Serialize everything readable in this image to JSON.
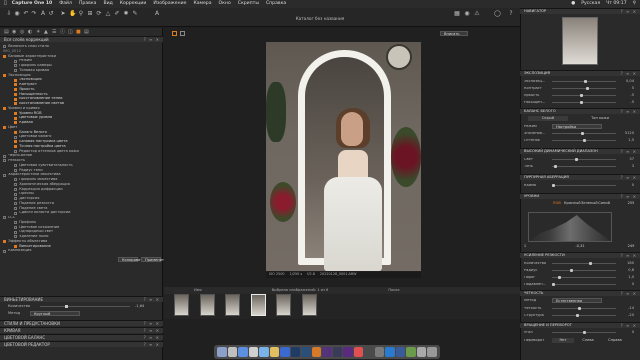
{
  "menubar": {
    "app_name": "Capture One 10",
    "items": [
      "Файл",
      "Правка",
      "Вид",
      "Коррекции",
      "Изображение",
      "Камера",
      "Окно",
      "Скрипты",
      "Справка"
    ],
    "status": {
      "language": "Русская",
      "clock": "Чт 09:17"
    }
  },
  "window": {
    "title": "Каталог без названия"
  },
  "viewer_toolbar": {
    "zoom_label": "Вписать"
  },
  "left_panel": {
    "layers_header": "Фоновый слой",
    "layers_header_sub": "Вся слоёв коррекций",
    "enable_layers": "Включить слои стиля",
    "tree_root": "IMG_0012",
    "items": [
      {
        "label": "Базовые характеристики",
        "level": 0,
        "on": true
      },
      {
        "label": "Режим",
        "level": 1,
        "on": false
      },
      {
        "label": "Профиль камеры",
        "level": 1,
        "on": false
      },
      {
        "label": "Тоновая кривая",
        "level": 1,
        "on": false
      },
      {
        "label": "Экспозиция",
        "level": 0,
        "on": true
      },
      {
        "label": "Экспозиция",
        "level": 1,
        "on": true
      },
      {
        "label": "Контраст",
        "level": 1,
        "on": true
      },
      {
        "label": "Яркость",
        "level": 1,
        "on": true
      },
      {
        "label": "Насыщенность",
        "level": 1,
        "on": true
      },
      {
        "label": "Восстановление теней",
        "level": 1,
        "on": true
      },
      {
        "label": "Восстановление светов",
        "level": 1,
        "on": true
      },
      {
        "label": "Уровни и кривая",
        "level": 0,
        "on": true
      },
      {
        "label": "Уровни RGB",
        "level": 1,
        "on": true
      },
      {
        "label": "Цветовые уровни",
        "level": 1,
        "on": true
      },
      {
        "label": "Кривая",
        "level": 1,
        "on": true
      },
      {
        "label": "Цвет",
        "level": 0,
        "on": true
      },
      {
        "label": "Баланс белого",
        "level": 1,
        "on": true
      },
      {
        "label": "Цветовой баланс",
        "level": 1,
        "on": false
      },
      {
        "label": "Базовая настройка цвета",
        "level": 1,
        "on": true
      },
      {
        "label": "Точная настройка цвета",
        "level": 1,
        "on": true
      },
      {
        "label": "Редактор оттенков цвета кожи",
        "level": 1,
        "on": false
      },
      {
        "label": "Черно-белое",
        "level": 0,
        "on": false
      },
      {
        "label": "Резкость",
        "level": 0,
        "on": false
      },
      {
        "label": "Цветовая чувствительность",
        "level": 1,
        "on": false
      },
      {
        "label": "Радиус тени",
        "level": 1,
        "on": false
      },
      {
        "label": "Характеристики объектива",
        "level": 0,
        "on": false
      },
      {
        "label": "Профиль объектива",
        "level": 1,
        "on": false
      },
      {
        "label": "Хроматическая аберрация",
        "level": 1,
        "on": false
      },
      {
        "label": "Коррекция дифракции",
        "level": 1,
        "on": false
      },
      {
        "label": "Ореолы",
        "level": 1,
        "on": false
      },
      {
        "label": "Дисторсия",
        "level": 1,
        "on": false
      },
      {
        "label": "Падение резкости",
        "level": 1,
        "on": false
      },
      {
        "label": "Падение света",
        "level": 1,
        "on": false
      },
      {
        "label": "Сдвиги области дисторсии",
        "level": 1,
        "on": false
      },
      {
        "label": "LCC",
        "level": 0,
        "on": false
      },
      {
        "label": "Профиль",
        "level": 1,
        "on": false
      },
      {
        "label": "Цветовое искажение",
        "level": 1,
        "on": false
      },
      {
        "label": "Однородный свет",
        "level": 1,
        "on": false
      },
      {
        "label": "Удаление пыли",
        "level": 1,
        "on": false
      },
      {
        "label": "Эффекты объектива",
        "level": 0,
        "on": true
      },
      {
        "label": "Виньетирование",
        "level": 1,
        "on": true
      },
      {
        "label": "Композиция",
        "level": 0,
        "on": false
      }
    ],
    "buttons": {
      "copy": "Копировать",
      "apply": "Применить"
    },
    "vignette": {
      "header": "ВИНЬЕТИРОВАНИЕ",
      "amount_label": "Количество",
      "amount_value": "-1,64",
      "method_label": "Метод",
      "method_value": "Круглый"
    },
    "bottom_sections": [
      "СТИЛИ И ПРЕДУСТАНОВКИ",
      "КРИВАЯ",
      "ЦВЕТОВОЙ БАЛАНС",
      "ЦВЕТОВОЙ РЕДАКТОР"
    ]
  },
  "photo_info": {
    "iso": "ISO 2500",
    "shutter": "1/250 s",
    "aperture": "f/2.8",
    "filename": "20220128_0001.ARW"
  },
  "filmstrip": {
    "sort_label": "Имя",
    "count_label": "Выбрано изображений: 1 из 6",
    "search_placeholder": "Поиск",
    "thumb_count": 6,
    "selected_index": 3
  },
  "right_panel": {
    "navigator": "НАВИГАТОР",
    "exposure": {
      "header": "ЭКСПОЗИЦИЯ",
      "rows": [
        {
          "label": "Экспозиц...",
          "value": "0,04",
          "pos": 0.52
        },
        {
          "label": "Контраст",
          "value": "5",
          "pos": 0.55
        },
        {
          "label": "Яркость",
          "value": "-5",
          "pos": 0.46
        },
        {
          "label": "Насыщен...",
          "value": "-5",
          "pos": 0.46
        }
      ]
    },
    "white_balance": {
      "header": "БАЛАНС БЕЛОГО",
      "tab_gray": "Серый",
      "tab_skin": "Тон кожи",
      "mode_label": "Режим",
      "mode_value": "Настройка",
      "rows": [
        {
          "label": "Значение...",
          "value": "5120",
          "pos": 0.48
        },
        {
          "label": "Оттенок",
          "value": "1,5",
          "pos": 0.51
        }
      ]
    },
    "hdr": {
      "header": "ВЫСОКИЙ ДИНАМИЧЕСКИЙ ДИАПАЗОН",
      "rows": [
        {
          "label": "Свет",
          "value": "37",
          "pos": 0.37
        },
        {
          "label": "Тень",
          "value": "3",
          "pos": 0.03
        }
      ]
    },
    "purple": {
      "header": "ПУРПУРНАЯ АБЕРРАЦИЯ",
      "rows": [
        {
          "label": "Кайма",
          "value": "0",
          "pos": 0.0
        }
      ]
    },
    "levels": {
      "header": "УРОВНИ",
      "channel_buttons": [
        "RGB",
        "Красный",
        "Зеленый",
        "Синий"
      ],
      "top_right": "255",
      "left_value": "1",
      "mid_value": "-0,31",
      "right_value": "249",
      "bottom_left": "0"
    },
    "sharpening": {
      "header": "УСИЛЕНИЕ РЕЗКОСТИ",
      "rows": [
        {
          "label": "Количество",
          "value": "180",
          "pos": 0.6
        },
        {
          "label": "Радиус",
          "value": "0,8",
          "pos": 0.3
        },
        {
          "label": "Порог",
          "value": "1,0",
          "pos": 0.1
        },
        {
          "label": "Подавлен...",
          "value": "0",
          "pos": 0.0
        }
      ]
    },
    "clarity": {
      "header": "ЧЕТКОСТЬ",
      "method_label": "Метод",
      "method_value": "Естественная",
      "rows": [
        {
          "label": "Четкость",
          "value": "-14",
          "pos": 0.43
        },
        {
          "label": "Структура",
          "value": "-20",
          "pos": 0.4
        }
      ]
    },
    "rotation": {
      "header": "ВРАЩЕНИЕ И ПЕРЕВОРОТ",
      "angle_label": "Угол",
      "angle_value": "0",
      "flip_label": "Переворот",
      "flip_none": "Нет",
      "flip_h": "Слева",
      "flip_v": "Справа"
    }
  },
  "colors": {
    "accent": "#e07a1e"
  }
}
